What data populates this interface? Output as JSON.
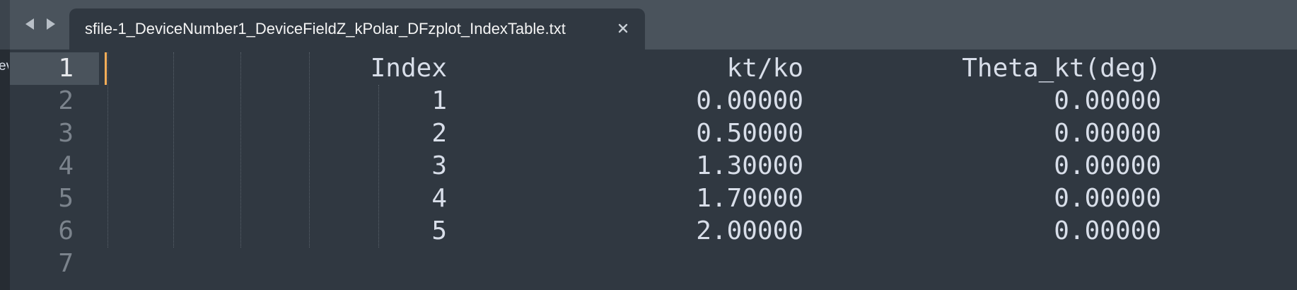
{
  "tab": {
    "title": "sfile-1_DeviceNumber1_DeviceFieldZ_kPolar_DFzplot_IndexTable.txt",
    "close_icon": "close-icon"
  },
  "nav": {
    "back_icon": "back-arrow-icon",
    "forward_icon": "forward-arrow-icon"
  },
  "sidebar": {
    "partial_text": "ev"
  },
  "editor": {
    "active_line": 1,
    "caret_color": "#f9ae58",
    "line_numbers": [
      "1",
      "2",
      "3",
      "4",
      "5",
      "6",
      "7"
    ],
    "header": {
      "index": "Index",
      "kt_ko": "kt/ko",
      "theta": "Theta_kt(deg)"
    },
    "rows": [
      {
        "index": "1",
        "kt_ko": "0.00000",
        "theta": "0.00000"
      },
      {
        "index": "2",
        "kt_ko": "0.50000",
        "theta": "0.00000"
      },
      {
        "index": "3",
        "kt_ko": "1.30000",
        "theta": "0.00000"
      },
      {
        "index": "4",
        "kt_ko": "1.70000",
        "theta": "0.00000"
      },
      {
        "index": "5",
        "kt_ko": "2.00000",
        "theta": "0.00000"
      }
    ]
  }
}
